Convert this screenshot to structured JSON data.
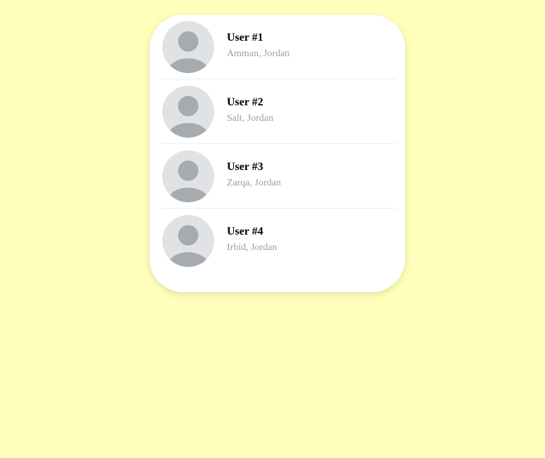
{
  "users": [
    {
      "name": "User #1",
      "location": "Amman, Jordan",
      "avatar_icon": "person-silhouette-icon"
    },
    {
      "name": "User #2",
      "location": "Salt, Jordan",
      "avatar_icon": "person-silhouette-icon"
    },
    {
      "name": "User #3",
      "location": "Zarqa, Jordan",
      "avatar_icon": "person-silhouette-icon"
    },
    {
      "name": "User #4",
      "location": "Irbid, Jordan",
      "avatar_icon": "person-silhouette-icon"
    }
  ],
  "colors": {
    "page_background": "#ffffbb",
    "card_background": "#ffffff",
    "avatar_background": "#e1e2e4",
    "avatar_figure": "#a6abb0",
    "name_text": "#000000",
    "location_text": "#9e9e9e"
  }
}
